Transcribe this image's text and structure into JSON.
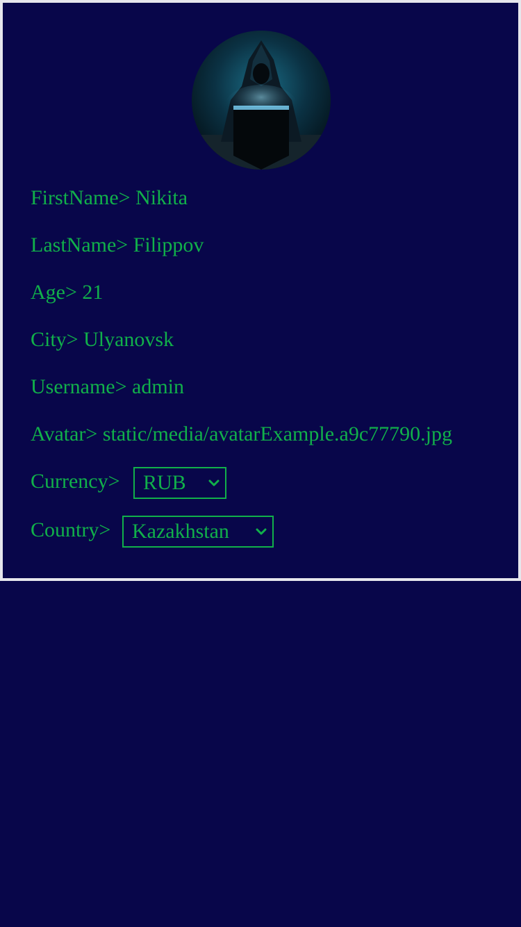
{
  "profile": {
    "avatar_icon": "hooded-hacker-avatar-image",
    "fields": [
      {
        "label": "FirstName> ",
        "value": "Nikita"
      },
      {
        "label": "LastName> ",
        "value": "Filippov"
      },
      {
        "label": "Age> ",
        "value": "21"
      },
      {
        "label": "City> ",
        "value": "Ulyanovsk"
      },
      {
        "label": "Username> ",
        "value": "admin"
      },
      {
        "label": "Avatar> ",
        "value": "static/media/avatarExample.a9c77790.jpg"
      }
    ],
    "currency": {
      "label": "Currency> ",
      "selected": "RUB"
    },
    "country": {
      "label": "Country> ",
      "selected": "Kazakhstan"
    }
  },
  "colors": {
    "background": "#08064a",
    "text": "#11b04a",
    "border": "#e6e6ec"
  }
}
